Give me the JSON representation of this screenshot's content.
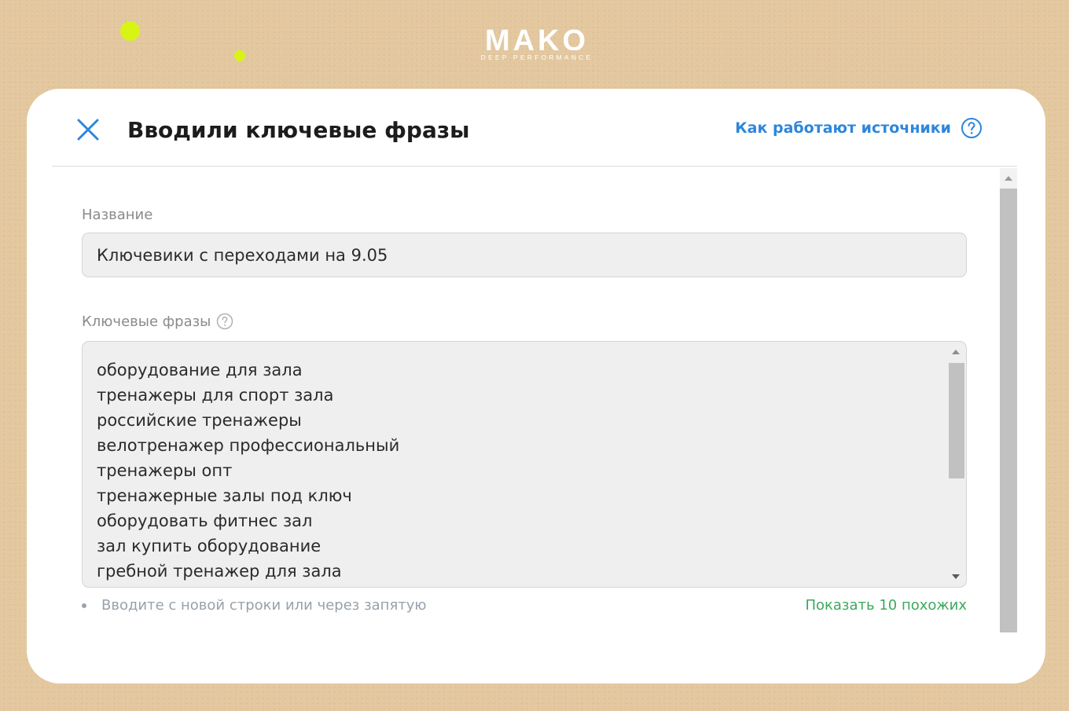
{
  "brand": {
    "name": "MAKO",
    "tagline": "DEEP PERFORMANCE",
    "accent": "#d7f416"
  },
  "modal": {
    "title": "Вводили ключевые фразы",
    "close_icon": "close-icon",
    "help_link": "Как работают источники",
    "help_icon": "question-circle-icon",
    "link_color": "#2d86dc"
  },
  "form": {
    "name_label": "Название",
    "name_value": "Ключевики с переходами на 9.05",
    "phrases_label": "Ключевые фразы",
    "phrases": [
      "оборудование для зала",
      "тренажеры для спорт зала",
      "российские тренажеры",
      "велотренажер профессиональный",
      "тренажеры опт",
      "тренажерные залы под ключ",
      "оборудовать фитнес зал",
      "зал купить оборудование",
      "гребной тренажер для зала"
    ],
    "hint": "Вводите с новой строки или через запятую",
    "similar_link": "Показать 10 похожих",
    "similar_color": "#3aa95a"
  }
}
